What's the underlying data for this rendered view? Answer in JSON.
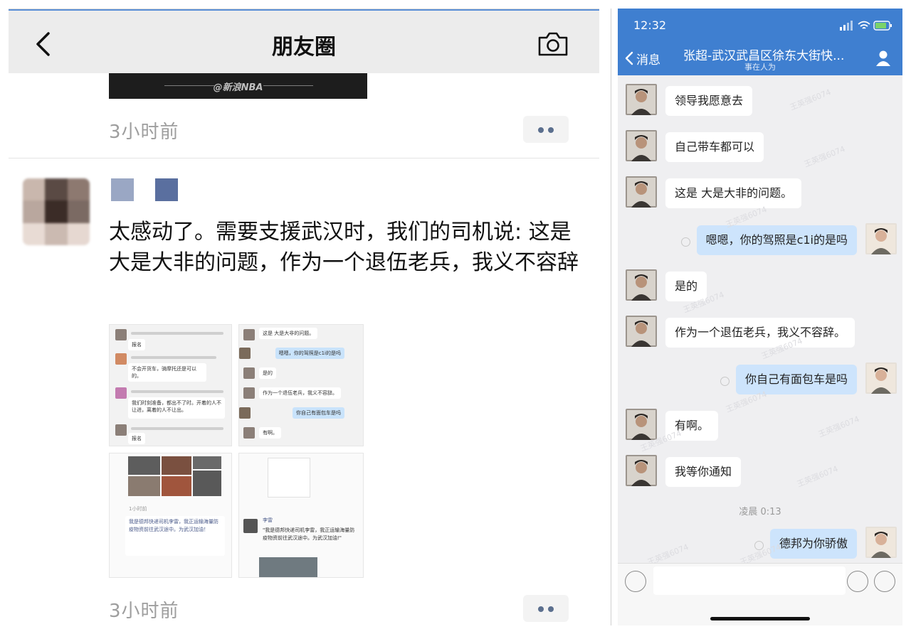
{
  "moments": {
    "header": {
      "title": "朋友圈"
    },
    "prev_post": {
      "image_watermark": "@新浪NBA",
      "time": "3小时前"
    },
    "post": {
      "name_block_colors": [
        "#9aa7c4",
        "#5a6f9f"
      ],
      "text": "太感动了。需要支援武汉时，我们的司机说: 这是大是大非的问题，作为一个退伍老兵，我义不容辞",
      "thumbnails": {
        "img1": {
          "caption": "报名",
          "lines": [
            "不会开货车，骑摩托还是可以的。",
            "我们时刻准备，都出不了时。开着的人不让进，离着的人不让出。",
            "报名"
          ]
        },
        "img2": {
          "bubbles": [
            "这是 大是大非的问题。",
            "嗯嗯，你的驾照是c1i的是吗",
            "是的",
            "作为一个退伍老兵，我义不容辞。",
            "你自己有面包车是吗",
            "有啊。"
          ]
        },
        "img3": {
          "caption": "1小时前",
          "text": "我是德邦快递司机李雷，我正运输海量防疫物资前往武汉途中。为武汉加油！"
        },
        "img4": {
          "name": "李雷",
          "quote": "\"我是德邦快递司机李雷，我正运输海量防疫物资前往武汉途中。为武汉加油!\""
        }
      },
      "time": "3小时前"
    }
  },
  "chat": {
    "status_bar": {
      "time": "12:32"
    },
    "nav": {
      "back_label": "消息",
      "title": "张超-武汉武昌区徐东大街快...",
      "subtitle": "事在人为"
    },
    "watermark": "王英强6074",
    "messages": [
      {
        "side": "left",
        "text": "领导我愿意去"
      },
      {
        "side": "left",
        "text": "自己带车都可以"
      },
      {
        "side": "left",
        "text": "这是  大是大非的问题。"
      },
      {
        "side": "right",
        "text": "嗯嗯，你的驾照是c1i的是吗"
      },
      {
        "side": "left",
        "text": "是的"
      },
      {
        "side": "left",
        "text": "作为一个退伍老兵，我义不容辞。"
      },
      {
        "side": "right",
        "text": "你自己有面包车是吗"
      },
      {
        "side": "left",
        "text": "有啊。"
      },
      {
        "side": "left",
        "text": "我等你通知"
      },
      {
        "side": "right",
        "text": "德邦为你骄傲"
      }
    ],
    "timestamp": "凌晨 0:13",
    "input": {
      "placeholder": ""
    },
    "colors": {
      "header": "#3f7fd0",
      "bubble_right": "#cde4fc",
      "bubble_left": "#ffffff"
    }
  }
}
